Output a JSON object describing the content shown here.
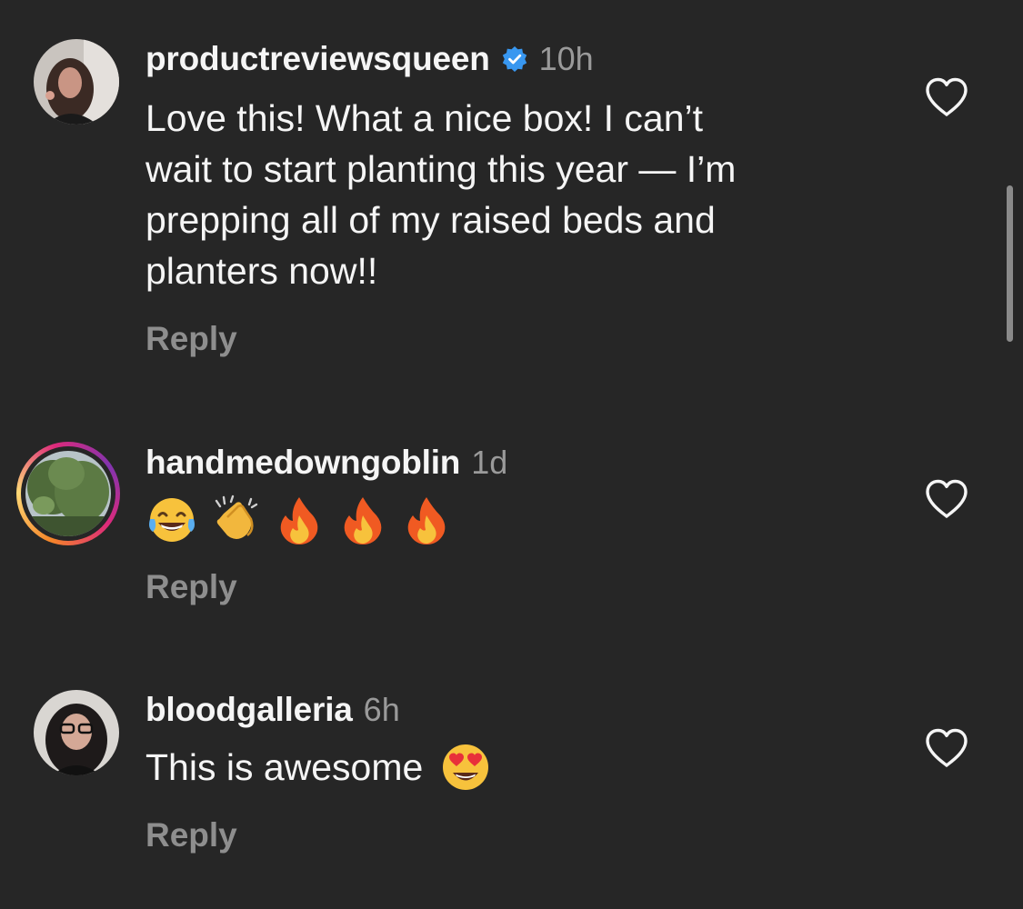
{
  "comments": [
    {
      "username": "productreviewsqueen",
      "verified": true,
      "time": "10h",
      "text": "Love this! What a nice box! I can’t\nwait to start planting this year — I’m\nprepping all of my raised beds and\nplanters now!!",
      "reply_label": "Reply",
      "avatar_icon": "avatar-photo"
    },
    {
      "username": "handmedowngoblin",
      "verified": false,
      "time": "1d",
      "emojis": [
        "tears-of-joy",
        "clapping-hands",
        "fire",
        "fire",
        "fire"
      ],
      "reply_label": "Reply",
      "has_story_ring": true,
      "avatar_icon": "avatar-tree-photo"
    },
    {
      "username": "bloodgalleria",
      "verified": false,
      "time": "6h",
      "text": "This is awesome",
      "trailing_emoji": "heart-eyes",
      "reply_label": "Reply",
      "avatar_icon": "avatar-photo"
    }
  ],
  "colors": {
    "background": "#262626",
    "text_primary": "#f5f5f5",
    "text_secondary": "#8e8e8e",
    "verified_blue": "#3897f0"
  },
  "icons": {
    "like": "heart-outline-icon",
    "verified": "verified-badge-icon"
  }
}
